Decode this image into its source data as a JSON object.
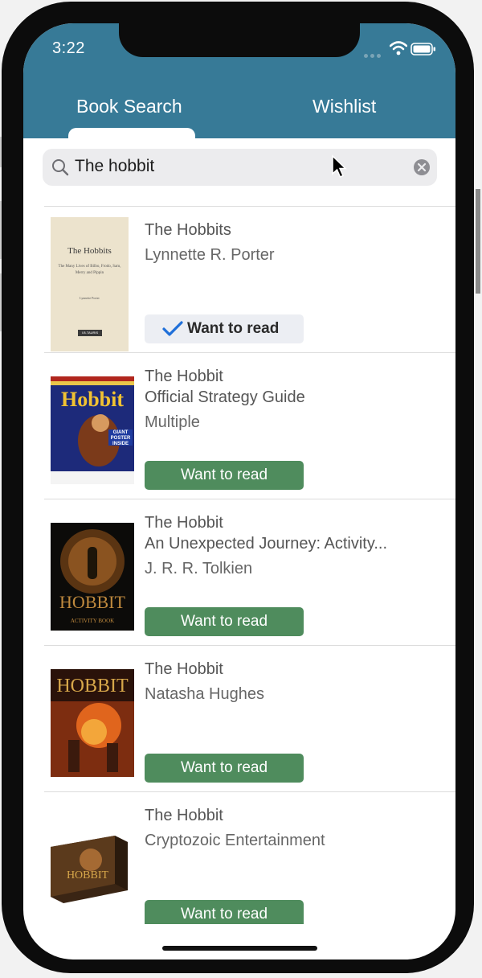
{
  "status_bar": {
    "time": "3:22"
  },
  "tabs": [
    {
      "label": "Book Search",
      "selected": true
    },
    {
      "label": "Wishlist",
      "selected": false
    }
  ],
  "search": {
    "value": "The hobbit"
  },
  "results": [
    {
      "title": "The Hobbits",
      "subtitle": "",
      "author": "Lynnette R. Porter",
      "button_label": "Want to read",
      "added": true,
      "cover_text": [
        "The Hobbits",
        "The Many Lives of Bilbo, Frodo, Sam, Merry and Pippin",
        "Lynnette Porter",
        "I.B.TAURIS"
      ]
    },
    {
      "title": "The Hobbit",
      "subtitle": "Official Strategy Guide",
      "author": "Multiple",
      "button_label": "Want to read",
      "added": false,
      "cover_text": [
        "Hobbit",
        "GIANT POSTER INSIDE"
      ]
    },
    {
      "title": "The Hobbit",
      "subtitle": "An Unexpected Journey: Activity...",
      "author": "J. R. R. Tolkien",
      "button_label": "Want to read",
      "added": false,
      "cover_text": [
        "HOBBIT",
        "ACTIVITY BOOK"
      ]
    },
    {
      "title": "The Hobbit",
      "subtitle": "",
      "author": "Natasha Hughes",
      "button_label": "Want to read",
      "added": false,
      "cover_text": [
        "HOBBIT"
      ]
    },
    {
      "title": "The Hobbit",
      "subtitle": "",
      "author": "Cryptozoic Entertainment",
      "button_label": "Want to read",
      "added": false,
      "cover_text": [
        "HOBBIT"
      ]
    }
  ],
  "colors": {
    "header": "#377a97",
    "button": "#4f8c5d",
    "button_added": "#eceef3",
    "check": "#1f6fd9"
  }
}
